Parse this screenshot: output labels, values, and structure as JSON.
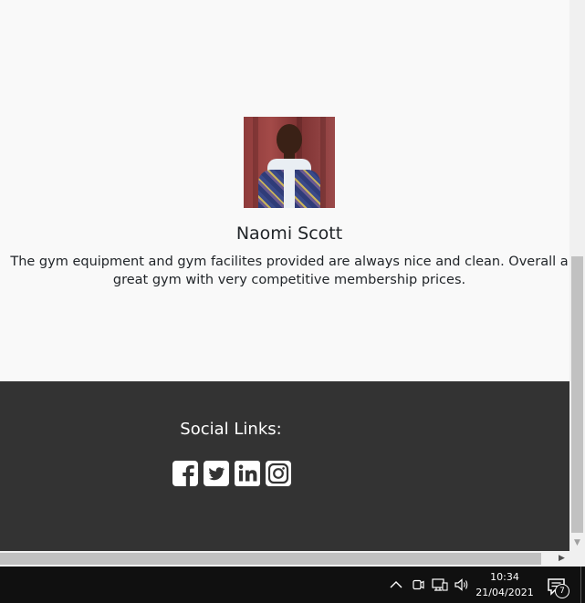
{
  "testimonial": {
    "name": "Naomi Scott",
    "quote": "The gym equipment and gym facilites provided are always nice and clean. Overall a great gym with very competitive membership prices."
  },
  "footer": {
    "social_title": "Social Links:",
    "social_links": [
      {
        "name": "facebook",
        "icon": "facebook-square-icon"
      },
      {
        "name": "twitter",
        "icon": "twitter-square-icon"
      },
      {
        "name": "linkedin",
        "icon": "linkedin-icon"
      },
      {
        "name": "instagram",
        "icon": "instagram-icon"
      }
    ]
  },
  "taskbar": {
    "time": "10:34",
    "date": "21/04/2021",
    "notification_count": "7",
    "tray_icons": [
      "chevron-up-icon",
      "meet-now-icon",
      "network-icon",
      "volume-icon",
      "action-center-icon"
    ]
  },
  "colors": {
    "page_bg": "#f9f9f9",
    "footer_bg": "#333333",
    "text": "#212529",
    "taskbar_bg": "#101010"
  }
}
